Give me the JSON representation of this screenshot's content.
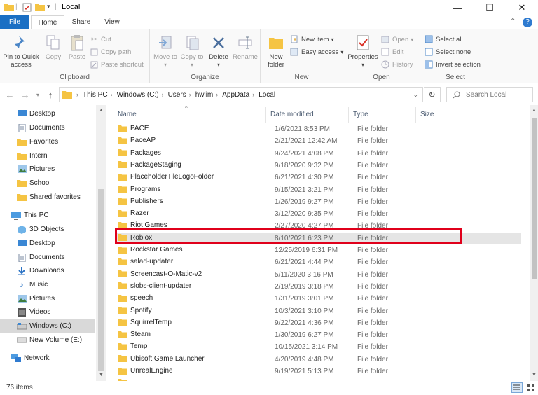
{
  "window": {
    "title": "Local",
    "controls": [
      "minimize",
      "maximize",
      "close"
    ]
  },
  "ribbon_tabs": {
    "file": "File",
    "home": "Home",
    "share": "Share",
    "view": "View"
  },
  "ribbon": {
    "clipboard": {
      "label": "Clipboard",
      "pin": "Pin to Quick access",
      "copy": "Copy",
      "paste": "Paste",
      "cut": "Cut",
      "copy_path": "Copy path",
      "paste_shortcut": "Paste shortcut"
    },
    "organize": {
      "label": "Organize",
      "move_to": "Move to",
      "copy_to": "Copy to",
      "delete": "Delete",
      "rename": "Rename"
    },
    "new": {
      "label": "New",
      "new_folder": "New folder",
      "new_item": "New item",
      "easy_access": "Easy access"
    },
    "open": {
      "label": "Open",
      "properties": "Properties",
      "open": "Open",
      "edit": "Edit",
      "history": "History"
    },
    "select": {
      "label": "Select",
      "select_all": "Select all",
      "select_none": "Select none",
      "invert": "Invert selection"
    }
  },
  "address": {
    "crumbs": [
      "This PC",
      "Windows (C:)",
      "Users",
      "hwlim",
      "AppData",
      "Local"
    ],
    "search_placeholder": "Search Local"
  },
  "nav_pane": {
    "quick_access": [
      "Desktop",
      "Documents",
      "Favorites",
      "Intern",
      "Pictures",
      "School",
      "Shared favorites"
    ],
    "this_pc_label": "This PC",
    "this_pc": [
      "3D Objects",
      "Desktop",
      "Documents",
      "Downloads",
      "Music",
      "Pictures",
      "Videos",
      "Windows (C:)",
      "New Volume (E:)"
    ],
    "network": "Network"
  },
  "columns": {
    "name": "Name",
    "date": "Date modified",
    "type": "Type",
    "size": "Size"
  },
  "files": [
    {
      "name": "PACE",
      "date": "1/6/2021 8:53 PM",
      "type": "File folder"
    },
    {
      "name": "PaceAP",
      "date": "2/21/2021 12:42 AM",
      "type": "File folder"
    },
    {
      "name": "Packages",
      "date": "9/24/2021 4:08 PM",
      "type": "File folder"
    },
    {
      "name": "PackageStaging",
      "date": "9/18/2020 9:32 PM",
      "type": "File folder"
    },
    {
      "name": "PlaceholderTileLogoFolder",
      "date": "6/21/2021 4:30 PM",
      "type": "File folder"
    },
    {
      "name": "Programs",
      "date": "9/15/2021 3:21 PM",
      "type": "File folder"
    },
    {
      "name": "Publishers",
      "date": "1/26/2019 9:27 PM",
      "type": "File folder"
    },
    {
      "name": "Razer",
      "date": "3/12/2020 9:35 PM",
      "type": "File folder"
    },
    {
      "name": "Riot Games",
      "date": "2/27/2020 4:27 PM",
      "type": "File folder"
    },
    {
      "name": "Roblox",
      "date": "8/10/2021 6:23 PM",
      "type": "File folder"
    },
    {
      "name": "Rockstar Games",
      "date": "12/25/2019 6:31 PM",
      "type": "File folder"
    },
    {
      "name": "salad-updater",
      "date": "6/21/2021 4:44 PM",
      "type": "File folder"
    },
    {
      "name": "Screencast-O-Matic-v2",
      "date": "5/11/2020 3:16 PM",
      "type": "File folder"
    },
    {
      "name": "slobs-client-updater",
      "date": "2/19/2019 3:18 PM",
      "type": "File folder"
    },
    {
      "name": "speech",
      "date": "1/31/2019 3:01 PM",
      "type": "File folder"
    },
    {
      "name": "Spotify",
      "date": "10/3/2021 3:10 PM",
      "type": "File folder"
    },
    {
      "name": "SquirrelTemp",
      "date": "9/22/2021 4:36 PM",
      "type": "File folder"
    },
    {
      "name": "Steam",
      "date": "1/30/2019 6:27 PM",
      "type": "File folder"
    },
    {
      "name": "Temp",
      "date": "10/15/2021 3:14 PM",
      "type": "File folder"
    },
    {
      "name": "Ubisoft Game Launcher",
      "date": "4/20/2019 4:48 PM",
      "type": "File folder"
    },
    {
      "name": "UnrealEngine",
      "date": "9/19/2021 5:13 PM",
      "type": "File folder"
    }
  ],
  "status": {
    "count": "76 items"
  },
  "colors": {
    "accent": "#1a6fc4",
    "highlight": "#e0001b",
    "folder": "#f5c443"
  }
}
